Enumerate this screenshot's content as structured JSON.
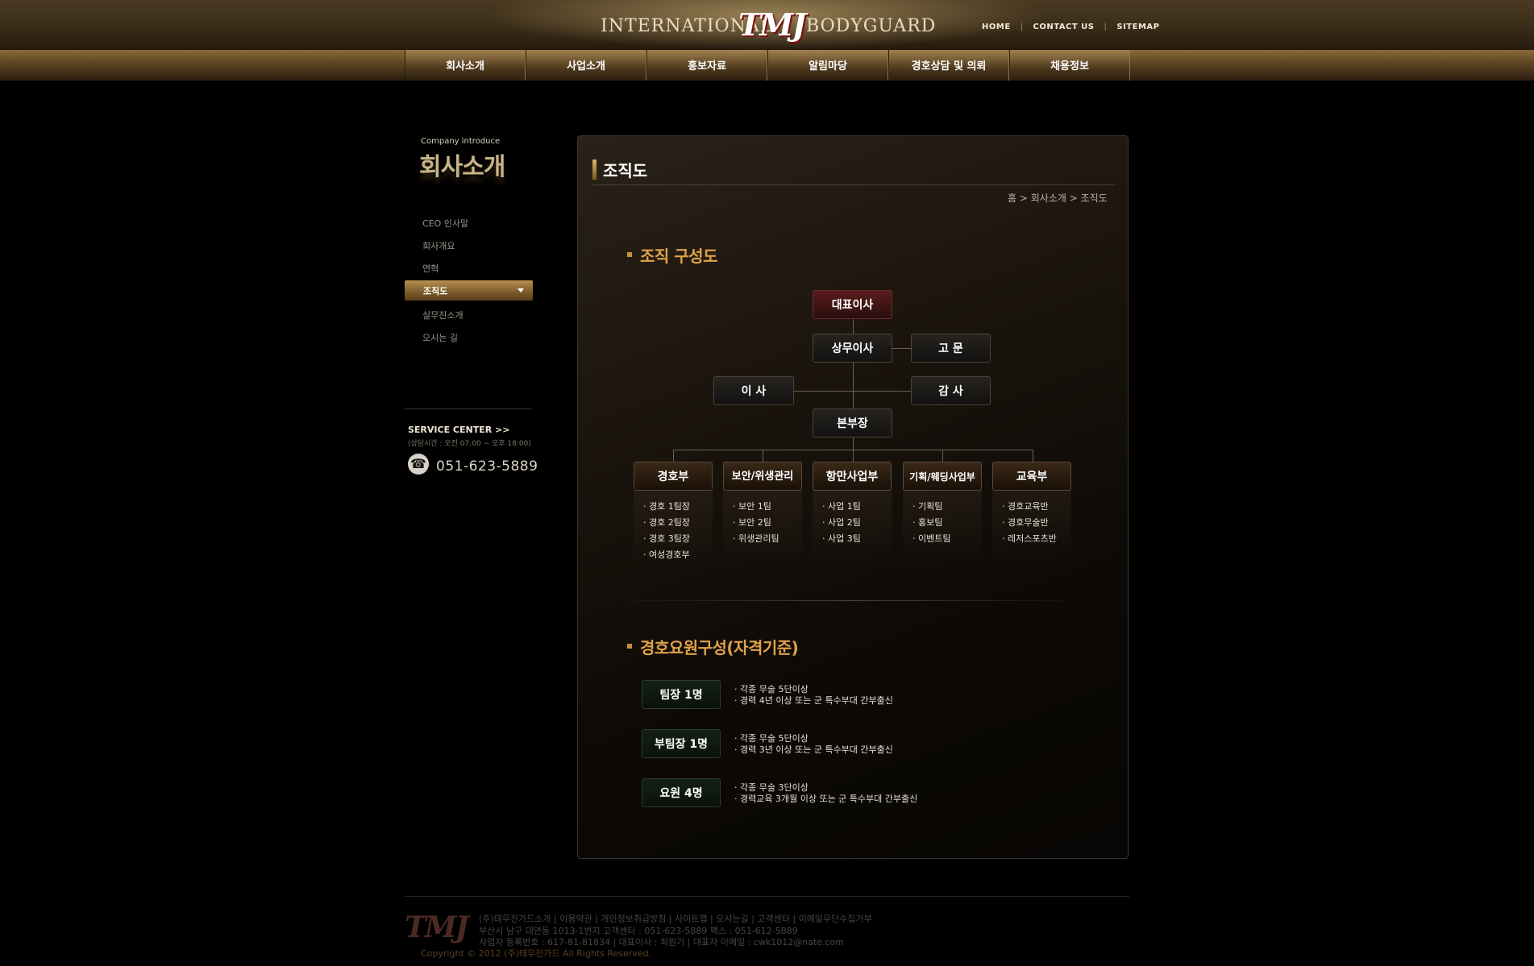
{
  "header": {
    "logo_left": "INTERNATIONAL",
    "logo_mark": "TMJ",
    "logo_right": "BODYGUARD",
    "util_links": [
      "HOME",
      "CONTACT US",
      "SITEMAP"
    ],
    "util_sep": "|"
  },
  "menu": [
    "회사소개",
    "사업소개",
    "홍보자료",
    "알림마당",
    "경호상담 및 의뢰",
    "채용정보"
  ],
  "sidebar": {
    "title_en": "Company introduce",
    "title_ko": "회사소개",
    "items": [
      "CEO 인사말",
      "회사개요",
      "연혁",
      "조직도",
      "실무진소개",
      "오시는 길"
    ],
    "active_index": 3,
    "service_title": "SERVICE CENTER >>",
    "service_hours": "(상담시간 : 오전 07:00 ~ 오후 18:00)",
    "phone": "051-623-5889",
    "phone_icon": "phone-icon"
  },
  "content": {
    "page_title": "조직도",
    "breadcrumb": "홈 > 회사소개 > 조직도",
    "section1_title": "조직 구성도",
    "section2_title": "경호요원구성(자격기준)"
  },
  "org": {
    "ceo": "대표이사",
    "managing": "상무이사",
    "advisor": "고 문",
    "director": "이 사",
    "auditor": "감 사",
    "hq": "본부장",
    "departments": [
      {
        "name": "경호부",
        "teams": [
          "경호 1팀장",
          "경호 2팀장",
          "경호 3팀장",
          "여성경호부"
        ]
      },
      {
        "name": "보안/위생관리",
        "teams": [
          "보안 1팀",
          "보안 2팀",
          "위생관리팀"
        ]
      },
      {
        "name": "항만사업부",
        "teams": [
          "사업 1팀",
          "사업 2팀",
          "사업 3팀"
        ]
      },
      {
        "name": "기획/웨딩사업부",
        "teams": [
          "기획팀",
          "홍보팀",
          "이벤트팀"
        ]
      },
      {
        "name": "교육부",
        "teams": [
          "경호교육반",
          "경호무술반",
          "레저스포츠반"
        ]
      }
    ]
  },
  "qualifications": [
    {
      "role": "팀장 1명",
      "lines": [
        "각종 무술 5단이상",
        "경력 4년 이상 또는 군 특수부대 간부출신"
      ]
    },
    {
      "role": "부팀장 1명",
      "lines": [
        "각종 무술 5단이상",
        "경력 3년 이상 또는 군 특수부대 간부출신"
      ]
    },
    {
      "role": "요원 4명",
      "lines": [
        "각종 무술 3단이상",
        "경력교육 3개월 이상 또는 군 특수부대 간부출신"
      ]
    }
  ],
  "footer": {
    "links": "(주)태무진가드소개 | 이용약관 | 개인정보취급방침 | 사이트맵 | 오시는길 | 고객센터 | 이메일무단수집거부",
    "address": "부산시 남구 대연동 1013-1번지 고객센터 : 051-623-5889 팩스 : 051-612-5889",
    "business": "사업자 등록번호 : 617-81-81834 | 대표이사 : 최원기 | 대표자 이메일 : cwk1012@nate.com",
    "copyright": "Copyright © 2012 (주)태무진가드 All Rights Reserved.",
    "logo": "TMJ"
  },
  "colors": {
    "accent_gold": "#e0a349",
    "menu_bar": "#5b4323",
    "ceo_box": "#5a1c1c"
  }
}
